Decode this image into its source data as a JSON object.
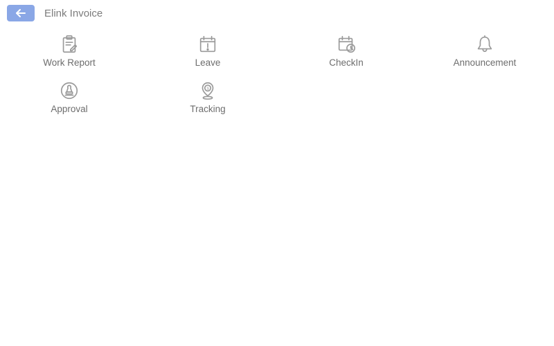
{
  "header": {
    "title": "Elink Invoice",
    "back_icon": "arrow-left"
  },
  "colors": {
    "accent": "#8aa7e6",
    "icon": "#9a9a9a",
    "text": "#6d6d6d"
  },
  "grid": {
    "items": [
      {
        "label": "Work Report",
        "icon": "clipboard-edit"
      },
      {
        "label": "Leave",
        "icon": "calendar-alert"
      },
      {
        "label": "CheckIn",
        "icon": "calendar-clock"
      },
      {
        "label": "Announcement",
        "icon": "bell"
      },
      {
        "label": "Approval",
        "icon": "stamp"
      },
      {
        "label": "Tracking",
        "icon": "location-dollar"
      }
    ]
  }
}
